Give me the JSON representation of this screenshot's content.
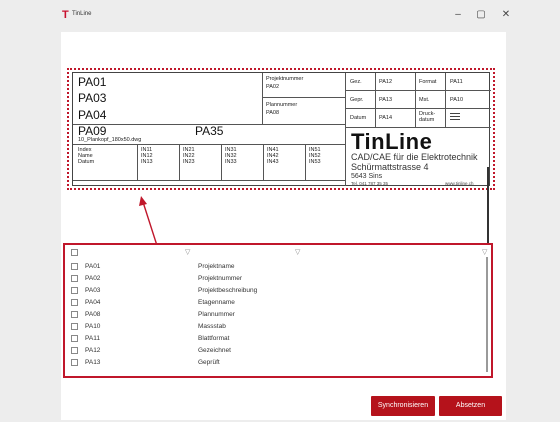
{
  "window": {
    "title": "TinLine",
    "controls": {
      "minimize": "–",
      "maximize": "▢",
      "close": "✕"
    }
  },
  "titleblock": {
    "left_big": [
      "PA01",
      "PA03",
      "PA04",
      "PA09"
    ],
    "pa35": "PA35",
    "filename": "10_Plankopf_180x50.dwg",
    "mid": {
      "projektnummer_label": "Projektnummer",
      "projektnummer_value": "PA02",
      "plannummer_label": "Plannummer",
      "plannummer_value": "PA08"
    },
    "right": {
      "gez_label": "Gez.",
      "gez_value": "PA12",
      "format_label": "Format",
      "format_value": "PA11",
      "gepr_label": "Gepr.",
      "gepr_value": "PA13",
      "mst_label": "Mst.",
      "mst_value": "PA10",
      "datum_label": "Datum",
      "datum_value": "PA14",
      "druck_label": "Druck-",
      "druck_label2": "datum"
    },
    "index_rows": [
      [
        "Index",
        "IN11",
        "IN21",
        "IN31",
        "IN41",
        "IN51"
      ],
      [
        "Name",
        "IN12",
        "IN22",
        "IN32",
        "IN42",
        "IN52"
      ],
      [
        "Datum",
        "IN13",
        "IN23",
        "IN33",
        "IN43",
        "IN53"
      ]
    ],
    "brand": {
      "name": "TinLine",
      "line1": "CAD/CAE für die Elektrotechnik",
      "line2": "Schürmattstrasse 4",
      "line3": "5643 Sins",
      "phone": "Tel. 041 787 35 35",
      "web": "www.tinline.ch"
    }
  },
  "list": {
    "rows": [
      {
        "code": "PA01",
        "desc": "Projektname"
      },
      {
        "code": "PA02",
        "desc": "Projektnummer"
      },
      {
        "code": "PA03",
        "desc": "Projektbeschreibung"
      },
      {
        "code": "PA04",
        "desc": "Etagenname"
      },
      {
        "code": "PA08",
        "desc": "Plannummer"
      },
      {
        "code": "PA10",
        "desc": "Massstab"
      },
      {
        "code": "PA11",
        "desc": "Blattformat"
      },
      {
        "code": "PA12",
        "desc": "Gezeichnet"
      },
      {
        "code": "PA13",
        "desc": "Geprüft"
      }
    ]
  },
  "buttons": {
    "sync": "Synchronisieren",
    "cancel": "Absetzen"
  },
  "colors": {
    "accent": "#b5121b"
  }
}
